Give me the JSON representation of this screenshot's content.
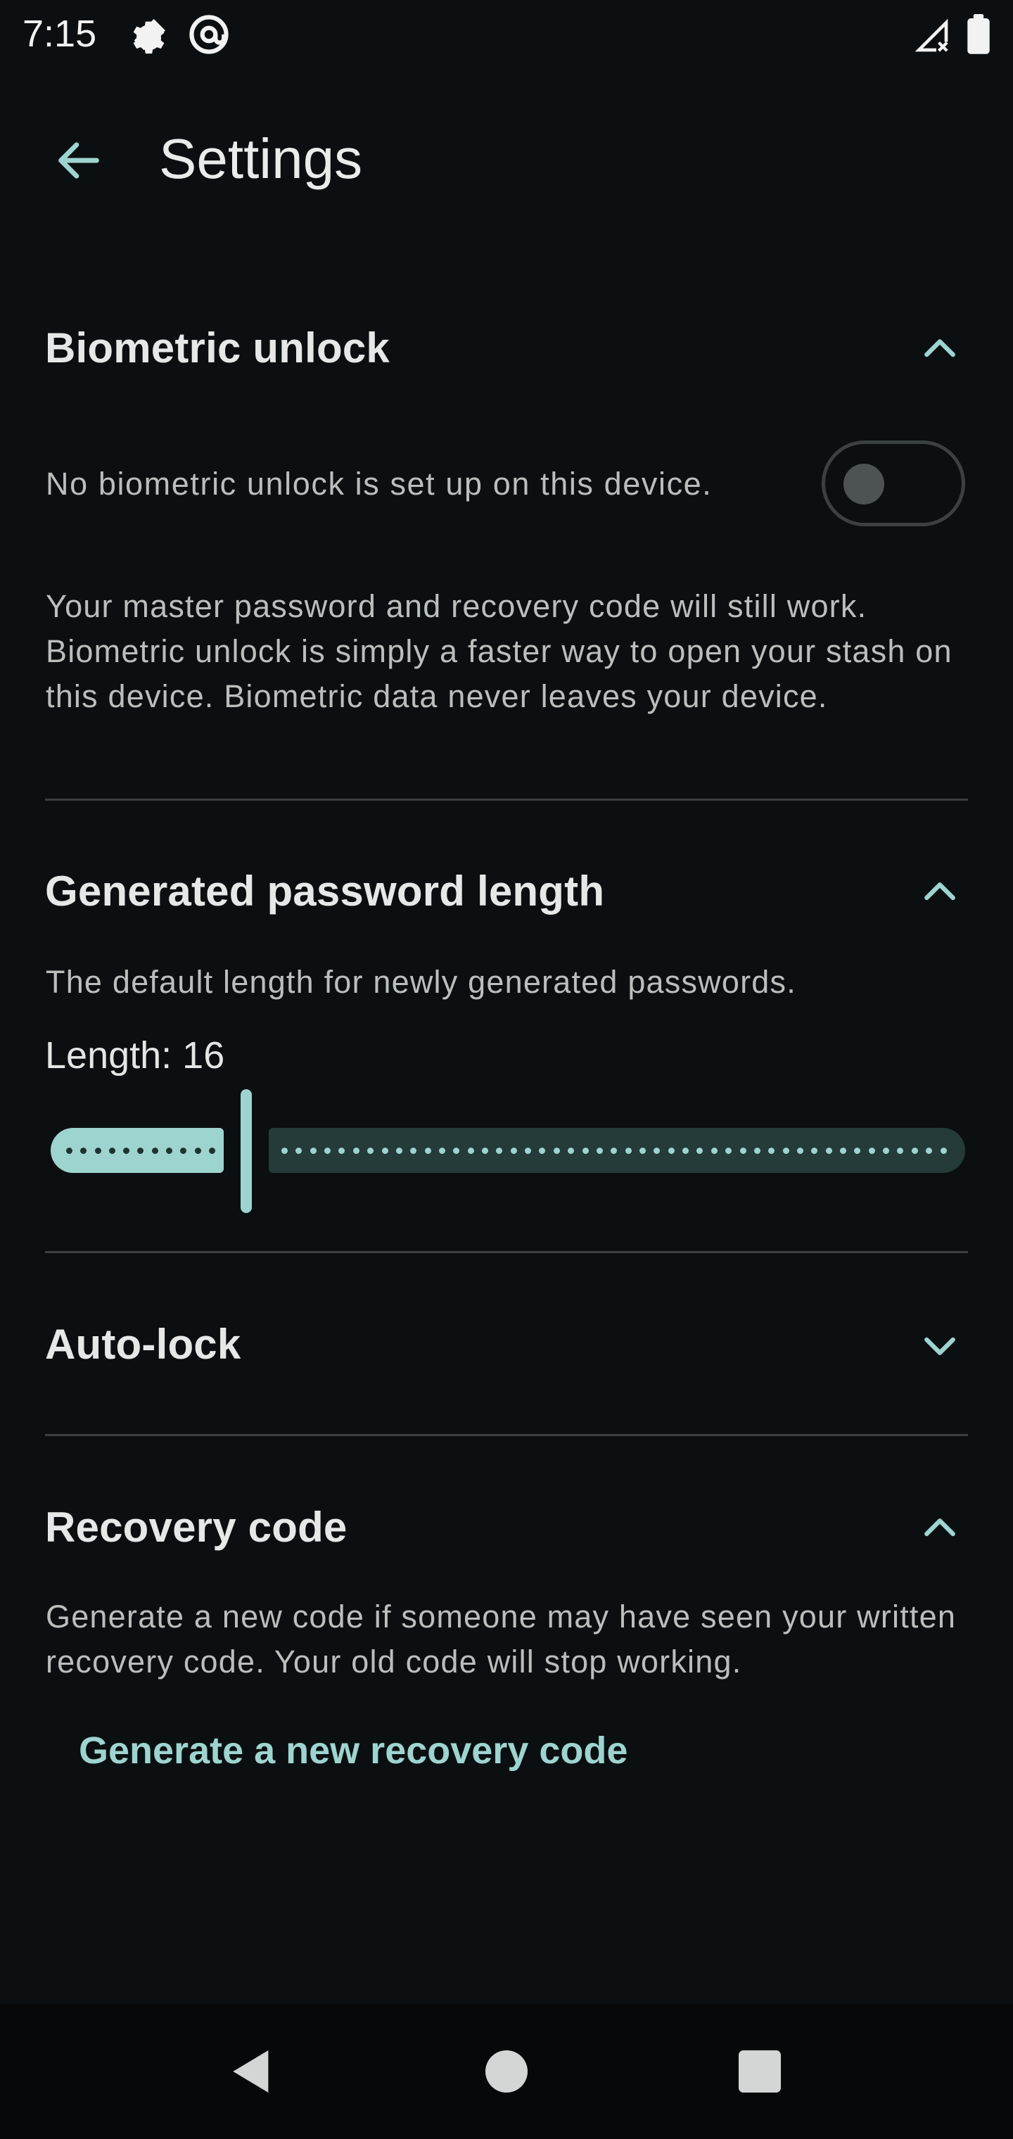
{
  "status_bar": {
    "time": "7:15",
    "icons": [
      "settings-gear-icon",
      "no-signal-satellite-icon",
      "at-sign-icon",
      "cellular-no-signal-icon",
      "battery-full-icon"
    ]
  },
  "app_bar": {
    "title": "Settings",
    "back_icon": "arrow-back-icon"
  },
  "sections": {
    "biometric": {
      "title": "Biometric unlock",
      "expanded": true,
      "toggle_label": "No biometric unlock is set up on this device.",
      "toggle_on": false,
      "description": "Your master password and recovery code will still work. Biometric unlock is simply a faster way to open your stash on this device. Biometric data never leaves your device."
    },
    "password_length": {
      "title": "Generated password length",
      "expanded": true,
      "description": "The default length for newly generated passwords.",
      "length_label": "Length: 16",
      "slider_fraction": 0.19
    },
    "autolock": {
      "title": "Auto-lock",
      "expanded": false
    },
    "recovery": {
      "title": "Recovery code",
      "expanded": true,
      "description": "Generate a new code if someone may have seen your written recovery code. Your old code will stop working.",
      "action_label": "Generate a new recovery code"
    }
  },
  "colors": {
    "background": "#0b0f11",
    "accent": "#9ed4cf",
    "divider": "#3a3f41",
    "text_secondary": "#b9bfbd"
  },
  "nav_bar": {
    "icons": [
      "back-triangle-icon",
      "home-circle-icon",
      "recents-square-icon"
    ]
  }
}
